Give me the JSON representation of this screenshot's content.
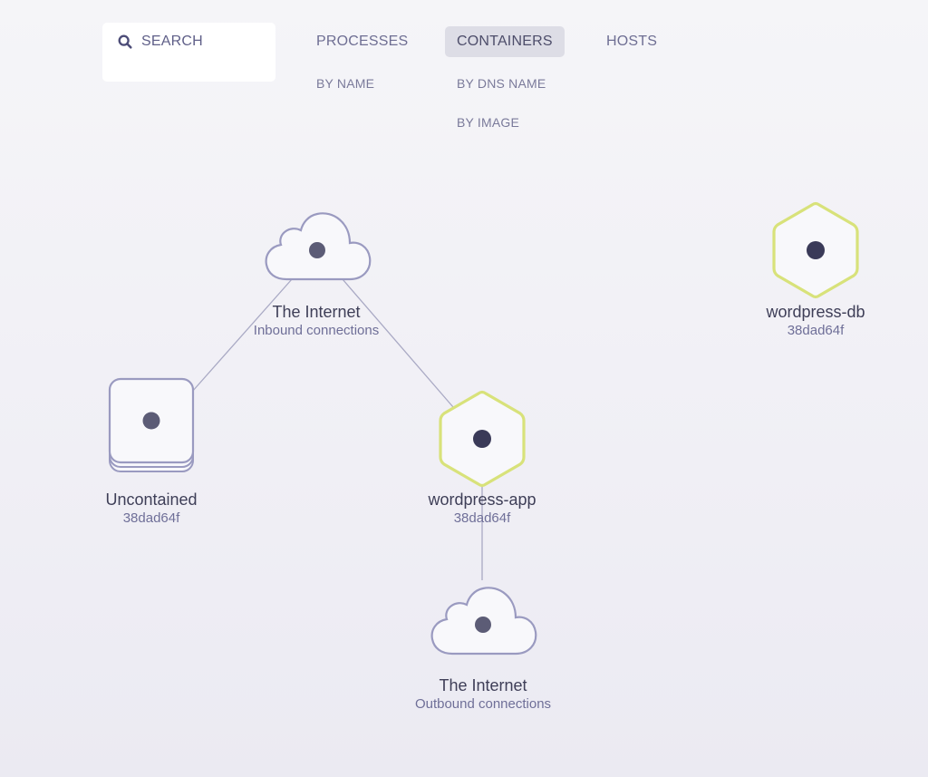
{
  "search": {
    "label": "SEARCH",
    "icon": "search-icon"
  },
  "topology": {
    "tabs": [
      {
        "label": "PROCESSES",
        "active": false,
        "sub": [
          "BY NAME"
        ]
      },
      {
        "label": "CONTAINERS",
        "active": true,
        "sub": [
          "BY DNS NAME",
          "BY IMAGE"
        ]
      },
      {
        "label": "HOSTS",
        "active": false,
        "sub": []
      }
    ]
  },
  "colors": {
    "highlight": "#d8e27a",
    "node_stroke": "#9a9ac0",
    "edge": "#a9a9c4",
    "dot": "#3a3a58",
    "dot_muted": "#5c5c76"
  },
  "graph": {
    "nodes": [
      {
        "id": "internet-in",
        "shape": "cloud",
        "label": "The Internet",
        "sublabel": "Inbound connections"
      },
      {
        "id": "uncontained",
        "shape": "stack",
        "label": "Uncontained",
        "sublabel": "38dad64f"
      },
      {
        "id": "wordpress-app",
        "shape": "hexagon",
        "highlighted": true,
        "label": "wordpress-app",
        "sublabel": "38dad64f"
      },
      {
        "id": "wordpress-db",
        "shape": "hexagon",
        "highlighted": true,
        "label": "wordpress-db",
        "sublabel": "38dad64f"
      },
      {
        "id": "internet-out",
        "shape": "cloud",
        "label": "The Internet",
        "sublabel": "Outbound connections"
      }
    ],
    "edges": [
      {
        "from": "internet-in",
        "to": "uncontained"
      },
      {
        "from": "internet-in",
        "to": "wordpress-app"
      },
      {
        "from": "wordpress-app",
        "to": "internet-out"
      }
    ]
  }
}
